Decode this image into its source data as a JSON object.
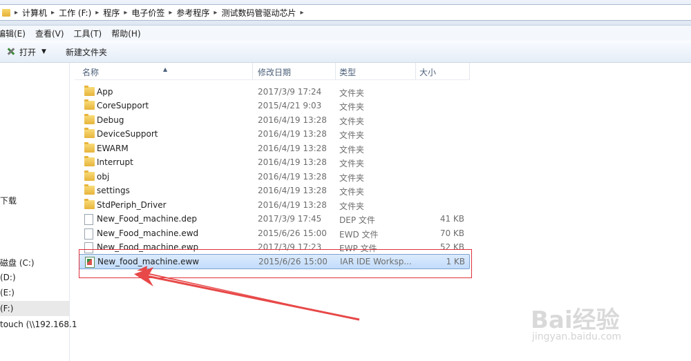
{
  "breadcrumb": [
    {
      "label": "计算机"
    },
    {
      "label": "工作 (F:)"
    },
    {
      "label": "程序"
    },
    {
      "label": "电子价签"
    },
    {
      "label": "参考程序"
    },
    {
      "label": "测试数码管驱动芯片"
    }
  ],
  "menu": {
    "edit": "编辑(E)",
    "view": "查看(V)",
    "tools": "工具(T)",
    "help": "帮助(H)"
  },
  "toolbar": {
    "open_label": "打开",
    "new_folder_label": "新建文件夹"
  },
  "nav": {
    "downloads": "下载",
    "drive_c": "磁盘 (C:)",
    "drive_d": "(D:)",
    "drive_e": "(E:)",
    "drive_f": "(F:)",
    "network": "touch (\\\\192.168.1"
  },
  "columns": {
    "name": "名称",
    "date": "修改日期",
    "type": "类型",
    "size": "大小"
  },
  "files": [
    {
      "name": "App",
      "date": "2017/3/9 17:24",
      "type": "文件夹",
      "size": "",
      "icon": "folder-icon"
    },
    {
      "name": "CoreSupport",
      "date": "2015/4/21 9:03",
      "type": "文件夹",
      "size": "",
      "icon": "folder-icon"
    },
    {
      "name": "Debug",
      "date": "2016/4/19 13:28",
      "type": "文件夹",
      "size": "",
      "icon": "folder-icon"
    },
    {
      "name": "DeviceSupport",
      "date": "2016/4/19 13:28",
      "type": "文件夹",
      "size": "",
      "icon": "folder-icon"
    },
    {
      "name": "EWARM",
      "date": "2016/4/19 13:28",
      "type": "文件夹",
      "size": "",
      "icon": "folder-icon"
    },
    {
      "name": "Interrupt",
      "date": "2016/4/19 13:28",
      "type": "文件夹",
      "size": "",
      "icon": "folder-icon"
    },
    {
      "name": "obj",
      "date": "2016/4/19 13:28",
      "type": "文件夹",
      "size": "",
      "icon": "folder-icon"
    },
    {
      "name": "settings",
      "date": "2016/4/19 13:28",
      "type": "文件夹",
      "size": "",
      "icon": "folder-icon"
    },
    {
      "name": "StdPeriph_Driver",
      "date": "2016/4/19 13:28",
      "type": "文件夹",
      "size": "",
      "icon": "folder-icon"
    },
    {
      "name": "New_Food_machine.dep",
      "date": "2017/3/9 17:45",
      "type": "DEP 文件",
      "size": "41 KB",
      "icon": "file-icon"
    },
    {
      "name": "New_Food_machine.ewd",
      "date": "2015/6/26 15:00",
      "type": "EWD 文件",
      "size": "70 KB",
      "icon": "file-icon"
    },
    {
      "name": "New_Food_machine.ewp",
      "date": "2017/3/9 17:23",
      "type": "EWP 文件",
      "size": "52 KB",
      "icon": "file-icon"
    },
    {
      "name": "New_food_machine.eww",
      "date": "2015/6/26 15:00",
      "type": "IAR IDE Worksp...",
      "size": "1 KB",
      "icon": "iar-workspace-icon"
    }
  ],
  "watermark": {
    "brand": "Bai经验",
    "url": "jingyan.baidu.com"
  },
  "annotation_color": "#e0303a"
}
